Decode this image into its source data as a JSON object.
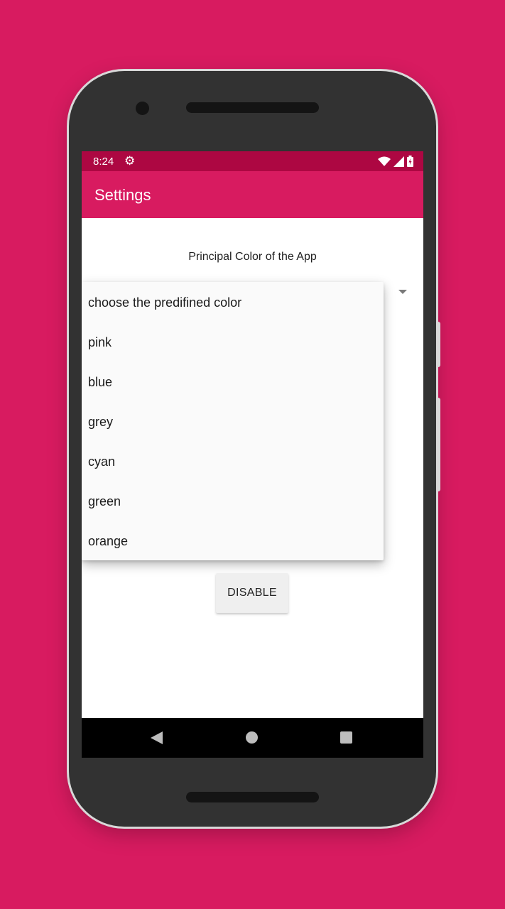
{
  "status_bar": {
    "time": "8:24",
    "settings_icon": "gear-icon",
    "icons": [
      "wifi-icon",
      "signal-icon",
      "battery-icon"
    ]
  },
  "app_bar": {
    "title": "Settings",
    "color": "#D81B60"
  },
  "main": {
    "label": "Principal Color of the App",
    "dropdown": {
      "expanded": true,
      "options": [
        "choose the predifined color",
        "pink",
        "blue",
        "grey",
        "cyan",
        "green",
        "orange"
      ]
    },
    "disable_button_label": "DISABLE"
  },
  "nav_bar": {
    "icons": [
      "back-icon",
      "home-icon",
      "recent-apps-icon"
    ]
  },
  "colors": {
    "background": "#D81B60",
    "status_bar": "#AD0742",
    "accent": "#D81B60"
  }
}
